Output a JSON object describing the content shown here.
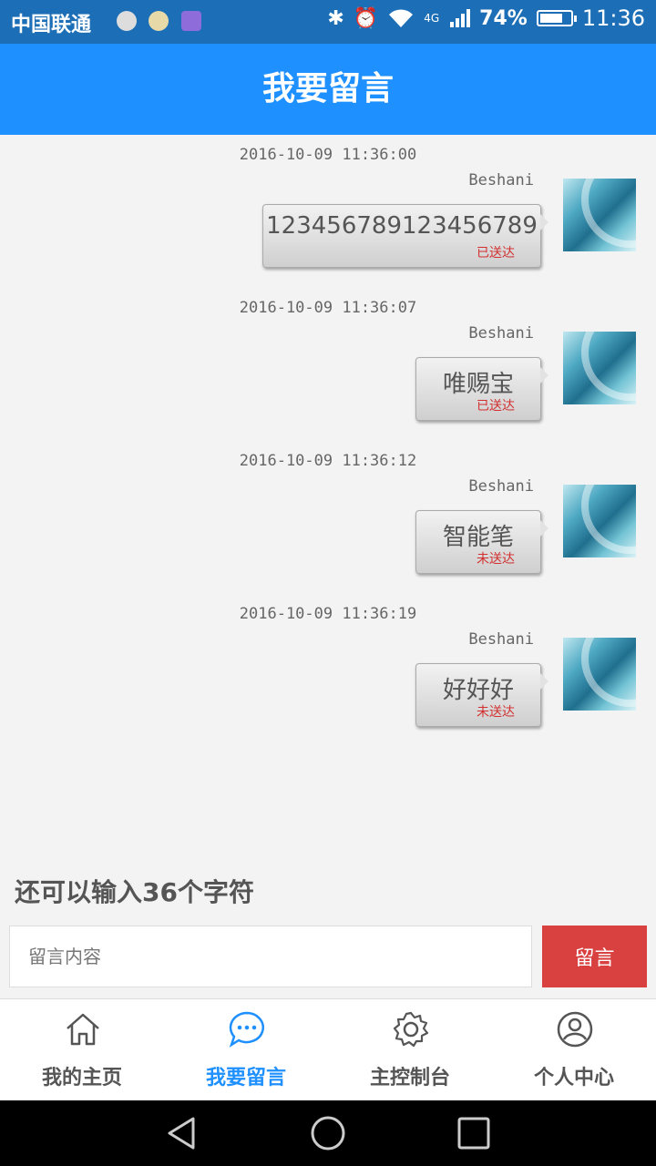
{
  "status_bar": {
    "carrier": "中国联通",
    "network": "4G",
    "battery": "74%",
    "battery_level": 0.74,
    "time": "11:36"
  },
  "header": {
    "title": "我要留言"
  },
  "messages": [
    {
      "time": "2016-10-09 11:36:00",
      "user": "Beshani",
      "text": "123456789123456789",
      "status": "已送达"
    },
    {
      "time": "2016-10-09 11:36:07",
      "user": "Beshani",
      "text": "唯赐宝",
      "status": "已送达"
    },
    {
      "time": "2016-10-09 11:36:12",
      "user": "Beshani",
      "text": "智能笔",
      "status": "未送达"
    },
    {
      "time": "2016-10-09 11:36:19",
      "user": "Beshani",
      "text": "好好好",
      "status": "未送达"
    }
  ],
  "composer": {
    "remaining_text": "还可以输入36个字符",
    "placeholder": "留言内容",
    "value": "",
    "send_label": "留言"
  },
  "tabs": [
    {
      "label": "我的主页",
      "icon": "home-icon",
      "active": false
    },
    {
      "label": "我要留言",
      "icon": "chat-icon",
      "active": true
    },
    {
      "label": "主控制台",
      "icon": "gear-icon",
      "active": false
    },
    {
      "label": "个人中心",
      "icon": "user-icon",
      "active": false
    }
  ],
  "colors": {
    "accent": "#1e90ff",
    "status_bar": "#1c6fb6",
    "send_button": "#d94040",
    "delivery_status": "#d32f2f"
  }
}
